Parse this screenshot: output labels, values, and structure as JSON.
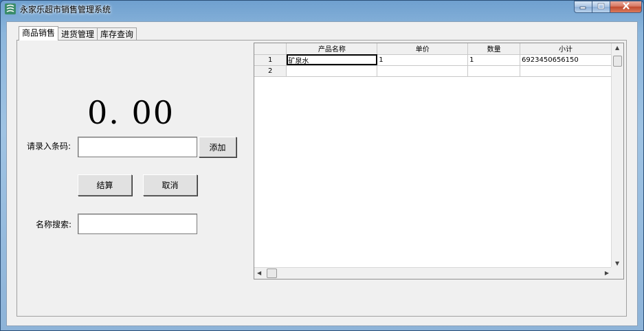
{
  "window": {
    "title": "永家乐超市销售管理系统"
  },
  "tabs": [
    {
      "label": "商品销售"
    },
    {
      "label": "进货管理"
    },
    {
      "label": "库存查询"
    }
  ],
  "sales": {
    "total_display": "0. 00",
    "barcode_label": "请录入条码:",
    "barcode_value": "",
    "add_button": "添加",
    "checkout_button": "结算",
    "cancel_button": "取消",
    "name_search_label": "名称搜索:",
    "name_search_value": ""
  },
  "grid": {
    "columns": [
      "产品名称",
      "单价",
      "数量",
      "小计"
    ],
    "rows": [
      {
        "num": "1",
        "cells": [
          "矿泉水",
          "1",
          "1",
          "6923450656150"
        ]
      },
      {
        "num": "2",
        "cells": [
          "",
          "",
          "",
          ""
        ]
      }
    ]
  },
  "icons": {
    "app": "app-logo-icon",
    "minimize": "minimize-icon",
    "maximize": "maximize-icon",
    "close": "close-icon",
    "scroll_up": "arrow-up-icon",
    "scroll_down": "arrow-down-icon",
    "scroll_left": "arrow-left-icon",
    "scroll_right": "arrow-right-icon"
  },
  "colors": {
    "titlebar": "#8cb6dc",
    "close_button": "#c14a2f",
    "face": "#f0f0f0"
  }
}
